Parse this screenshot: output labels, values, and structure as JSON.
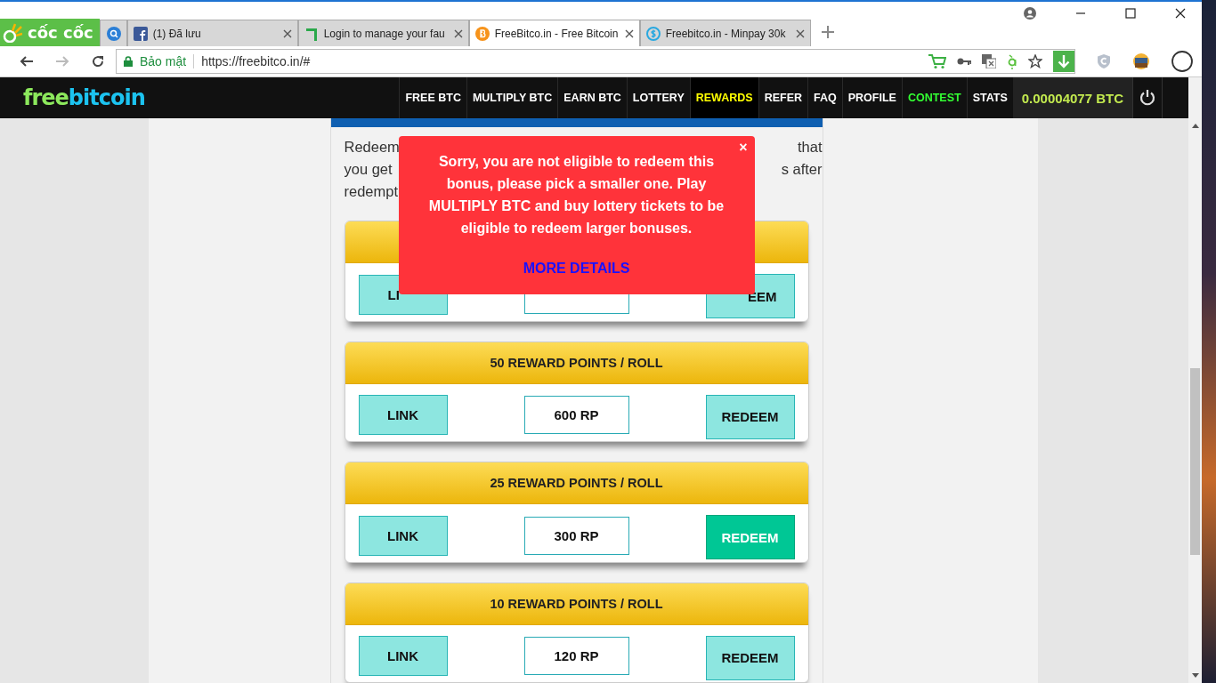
{
  "browser": {
    "brand": "cốc cốc",
    "tabs": [
      {
        "label": "(1) Đã lưu",
        "selected": false
      },
      {
        "label": "Login to manage your fau",
        "selected": false
      },
      {
        "label": "FreeBitco.in - Free Bitcoin",
        "selected": true
      },
      {
        "label": "Freebitco.in - Minpay 30k",
        "selected": false
      }
    ],
    "security": "Bảo mật",
    "url": "https://freebitco.in/#"
  },
  "nav": {
    "logo_a": "free",
    "logo_b": "bitcoin",
    "items": [
      {
        "label": "FREE BTC",
        "selected": false,
        "kind": "plain"
      },
      {
        "label": "MULTIPLY BTC",
        "selected": false,
        "kind": "plain"
      },
      {
        "label": "EARN BTC",
        "selected": false,
        "kind": "plain"
      },
      {
        "label": "LOTTERY",
        "selected": false,
        "kind": "plain"
      },
      {
        "label": "REWARDS",
        "selected": true,
        "kind": "plain"
      },
      {
        "label": "REFER",
        "selected": false,
        "kind": "plain"
      },
      {
        "label": "FAQ",
        "selected": false,
        "kind": "plain"
      },
      {
        "label": "PROFILE",
        "selected": false,
        "kind": "plain"
      },
      {
        "label": "CONTEST",
        "selected": false,
        "kind": "contest"
      },
      {
        "label": "STATS",
        "selected": false,
        "kind": "plain"
      }
    ],
    "balance": "0.00004077 BTC"
  },
  "intro": {
    "left": [
      "Redeem",
      "you get",
      "redempt"
    ],
    "right": [
      "that",
      "s after"
    ]
  },
  "cards": [
    {
      "partial": true,
      "link": "LI",
      "redeem": "EEM",
      "highlighted": false
    },
    {
      "partial": false,
      "header": "50 REWARD POINTS / ROLL",
      "link": "LINK",
      "amount": "600 RP",
      "redeem": "REDEEM",
      "highlighted": false
    },
    {
      "partial": false,
      "header": "25 REWARD POINTS / ROLL",
      "link": "LINK",
      "amount": "300 RP",
      "redeem": "REDEEM",
      "highlighted": true
    },
    {
      "partial": false,
      "header": "10 REWARD POINTS / ROLL",
      "link": "LINK",
      "amount": "120 RP",
      "redeem": "REDEEM",
      "highlighted": false
    }
  ],
  "popup": {
    "message": "Sorry, you are not eligible to redeem this bonus, please pick a smaller one. Play MULTIPLY BTC and buy lottery tickets to be eligible to redeem larger bonuses.",
    "link": "MORE DETAILS",
    "close": "×"
  }
}
